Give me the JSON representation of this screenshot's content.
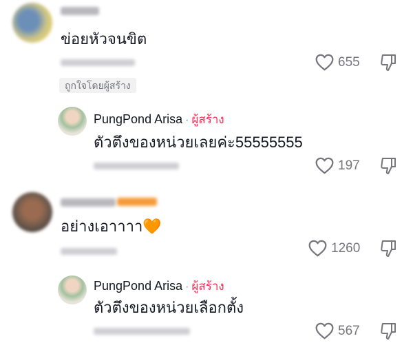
{
  "comments": [
    {
      "text": "ข่อยหัวจนขิต",
      "likes": "655",
      "liked_by_creator": "ถูกใจโดยผู้สร้าง",
      "reply": {
        "author": "PungPond Arisa",
        "separator": "·",
        "creator_badge": "ผู้สร้าง",
        "text": "ตัวตึงของหน่วยเลยค่ะ55555555",
        "likes": "197"
      }
    },
    {
      "text": "อย่างเอาาาา🧡",
      "likes": "1260",
      "reply": {
        "author": "PungPond Arisa",
        "separator": "·",
        "creator_badge": "ผู้สร้าง",
        "text": "ตัวตึงของหน่วยเลือกตั้ง",
        "likes": "567"
      }
    }
  ],
  "icons": {
    "like": "heart-outline-icon",
    "dislike": "thumbs-down-outline-icon"
  },
  "colors": {
    "creator_badge": "#fe2c55",
    "meta_text": "#75767c",
    "primary_text": "#161823"
  }
}
